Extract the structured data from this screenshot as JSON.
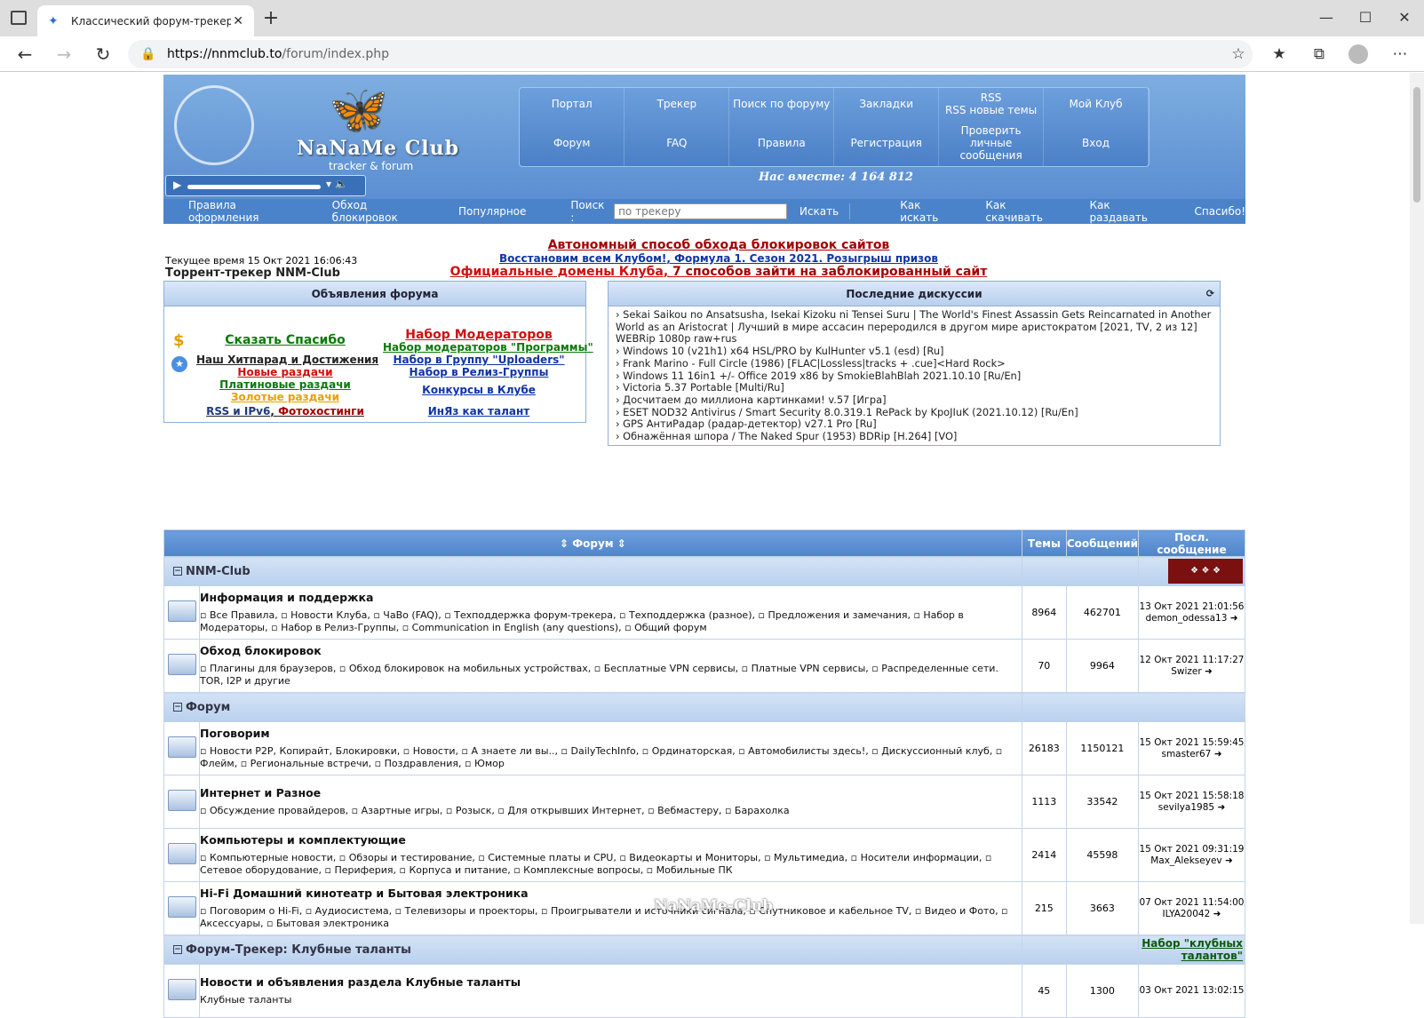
{
  "browser": {
    "tab_title": "Классический форум-трекер :: ",
    "url_domain": "https://nnmclub.to",
    "url_path": "/forum/index.php"
  },
  "header": {
    "logo": "NaNaMe Club",
    "logo_sub": "tracker & forum",
    "together": "Нас вместе: 4 164 812",
    "menu_top": [
      "Портал",
      "Трекер",
      "Поиск по форуму",
      "Закладки",
      "RSS\nRSS новые темы",
      "Мой Клуб"
    ],
    "menu_bottom": [
      "Форум",
      "FAQ",
      "Правила",
      "Регистрация",
      "Проверить личные\nсообщения",
      "Вход"
    ]
  },
  "subnav": {
    "items": [
      "Правила оформления",
      "Обход блокировок",
      "Популярное"
    ],
    "search_label": "Поиск :",
    "search_placeholder": "по трекеру",
    "search_button": "Искать",
    "help": [
      "Как искать",
      "Как скачивать",
      "Как раздавать",
      "Спасибо!"
    ]
  },
  "info": {
    "time": "Текущее время 15 Окт 2021 16:06:43",
    "tracker": "Торрент-трекер NNM-Club",
    "line1": "Автономный способ обхода блокировок сайтов",
    "line2a": "Восстановим всем Клубом!",
    "line2b": "Формула 1. Сезон 2021. Розыгрыш призов",
    "line3a": "Официальные домены Клуба",
    "line3b": "7 способов зайти на заблокированный сайт"
  },
  "announce": {
    "title": "Объявления форума",
    "thanks": "Сказать Спасибо",
    "hitparade": "Наш Хитпарад и Достижения",
    "new": "Новые раздачи",
    "paid": "Платиновые раздачи",
    "gold": "Золотые раздачи",
    "rss": "RSS и IPv6",
    "photo": "Фотохостинги",
    "mods": "Набор Модераторов",
    "mods_prog": "Набор модераторов \"Программы\"",
    "uploaders": "Набор в Группу \"Uploaders\"",
    "release": "Набор в Релиз-Группы",
    "contests": "Конкурсы в Клубе",
    "lang": "ИнЯз как талант"
  },
  "discussions": {
    "title": "Последние дискуссии",
    "items": [
      "› Sekai Saikou no Ansatsusha, Isekai Kizoku ni Tensei Suru | The World's Finest Assassin Gets Reincarnated in Another World as an Aristocrat | Лучший в мире ассасин переродился в другом мире аристократом [2021, TV, 2 из 12] WEBRip 1080p raw+rus",
      "› Windows 10 (v21h1) x64 HSL/PRO by KulHunter v5.1 (esd) [Ru]",
      "› Frank Marino - Full Circle (1986) [FLAC|Lossless|tracks + .cue]<Hard Rock>",
      "› Windows 11 16in1 +/- Office 2019 x86 by SmokieBlahBlah 2021.10.10 [Ru/En]",
      "› Victoria 5.37 Portable [Multi/Ru]",
      "› Досчитаем до миллиона картинками! v.57 [Игра]",
      "› ESET NOD32 Antivirus / Smart Security 8.0.319.1 RePack by KpoJIuK (2021.10.12) [Ru/En]",
      "› GPS АнтиРадар (радар-детектор) v27.1 Pro [Ru]",
      "› Обнажённая шпора / The Naked Spur (1953) BDRip [H.264] [VO]"
    ]
  },
  "table": {
    "h_forum": "Форум",
    "h_topics": "Темы",
    "h_posts": "Сообщений",
    "h_last": "Посл. сообщение",
    "cat1": "NNM-Club",
    "cat2": "Форум",
    "cat3": "Форум-Трекер: Клубные таланты",
    "cat3_link": "Набор \"клубных талантов\"",
    "rows": [
      {
        "name": "Информация и поддержка",
        "sub": "▫ Все Правила, ▫ Новости Клуба, ▫ ЧаВо (FAQ), ▫ Техподдержка форум-трекера, ▫ Техподдержка (разное), ▫ Предложения и замечания, ▫ Набор в Модераторы, ▫ Набор в Релиз-Группы, ▫ Communication in English (any questions), ▫ Общий форум",
        "topics": "8964",
        "posts": "462701",
        "date": "13 Окт 2021 21:01:56",
        "user": "demon_odessa13"
      },
      {
        "name": "Обход блокировок",
        "sub": "▫ Плагины для браузеров, ▫ Обход блокировок на мобильных устройствах, ▫ Бесплатные VPN сервисы, ▫ Платные VPN сервисы, ▫ Распределенные сети. TOR, I2P и другие",
        "topics": "70",
        "posts": "9964",
        "date": "12 Окт 2021 11:17:27",
        "user": "Swizer"
      },
      {
        "name": "Поговорим",
        "sub": "▫ Новости P2P, Копирайт, Блокировки, ▫ Новости, ▫ А знаете ли вы.., ▫ DailyTechInfo, ▫ Ординаторская, ▫ Автомобилисты здесь!, ▫ Дискуссионный клуб, ▫ Флейм, ▫ Региональные встречи, ▫ Поздравления, ▫ Юмор",
        "topics": "26183",
        "posts": "1150121",
        "date": "15 Окт 2021 15:59:45",
        "user": "smaster67"
      },
      {
        "name": "Интернет и Разное",
        "sub": "▫ Обсуждение провайдеров, ▫ Азартные игры, ▫ Розыск, ▫ Для открывших Интернет, ▫ Вебмастеру, ▫ Барахолка",
        "topics": "1113",
        "posts": "33542",
        "date": "15 Окт 2021 15:58:18",
        "user": "sevilya1985"
      },
      {
        "name": "Компьютеры и комплектующие",
        "sub": "▫ Компьютерные новости, ▫ Обзоры и тестирование, ▫ Системные платы и CPU, ▫ Видеокарты и Мониторы, ▫ Мультимедиа, ▫ Носители информации, ▫ Сетевое оборудование, ▫ Периферия, ▫ Корпуса и питание, ▫ Комплексные вопросы, ▫ Мобильные ПК",
        "topics": "2414",
        "posts": "45598",
        "date": "15 Окт 2021 09:31:19",
        "user": "Max_Alekseyev"
      },
      {
        "name": "Hi-Fi Домашний кинотеатр и Бытовая электроника",
        "sub": "▫ Поговорим о Hi-Fi, ▫ Аудиосистема, ▫ Телевизоры и проекторы, ▫ Проигрыватели и источники сигнала, ▫ Спутниковое и кабельное TV, ▫ Видео и Фото, ▫ Аксессуары, ▫ Бытовая электроника",
        "topics": "215",
        "posts": "3663",
        "date": "07 Окт 2021 11:54:00",
        "user": "ILYA20042"
      },
      {
        "name": "Новости и объявления раздела Клубные таланты",
        "sub": "Клубные таланты",
        "topics": "45",
        "posts": "1300",
        "date": "03 Окт 2021 13:02:15",
        "user": ""
      }
    ]
  },
  "watermark": "NaNaMe-Club"
}
